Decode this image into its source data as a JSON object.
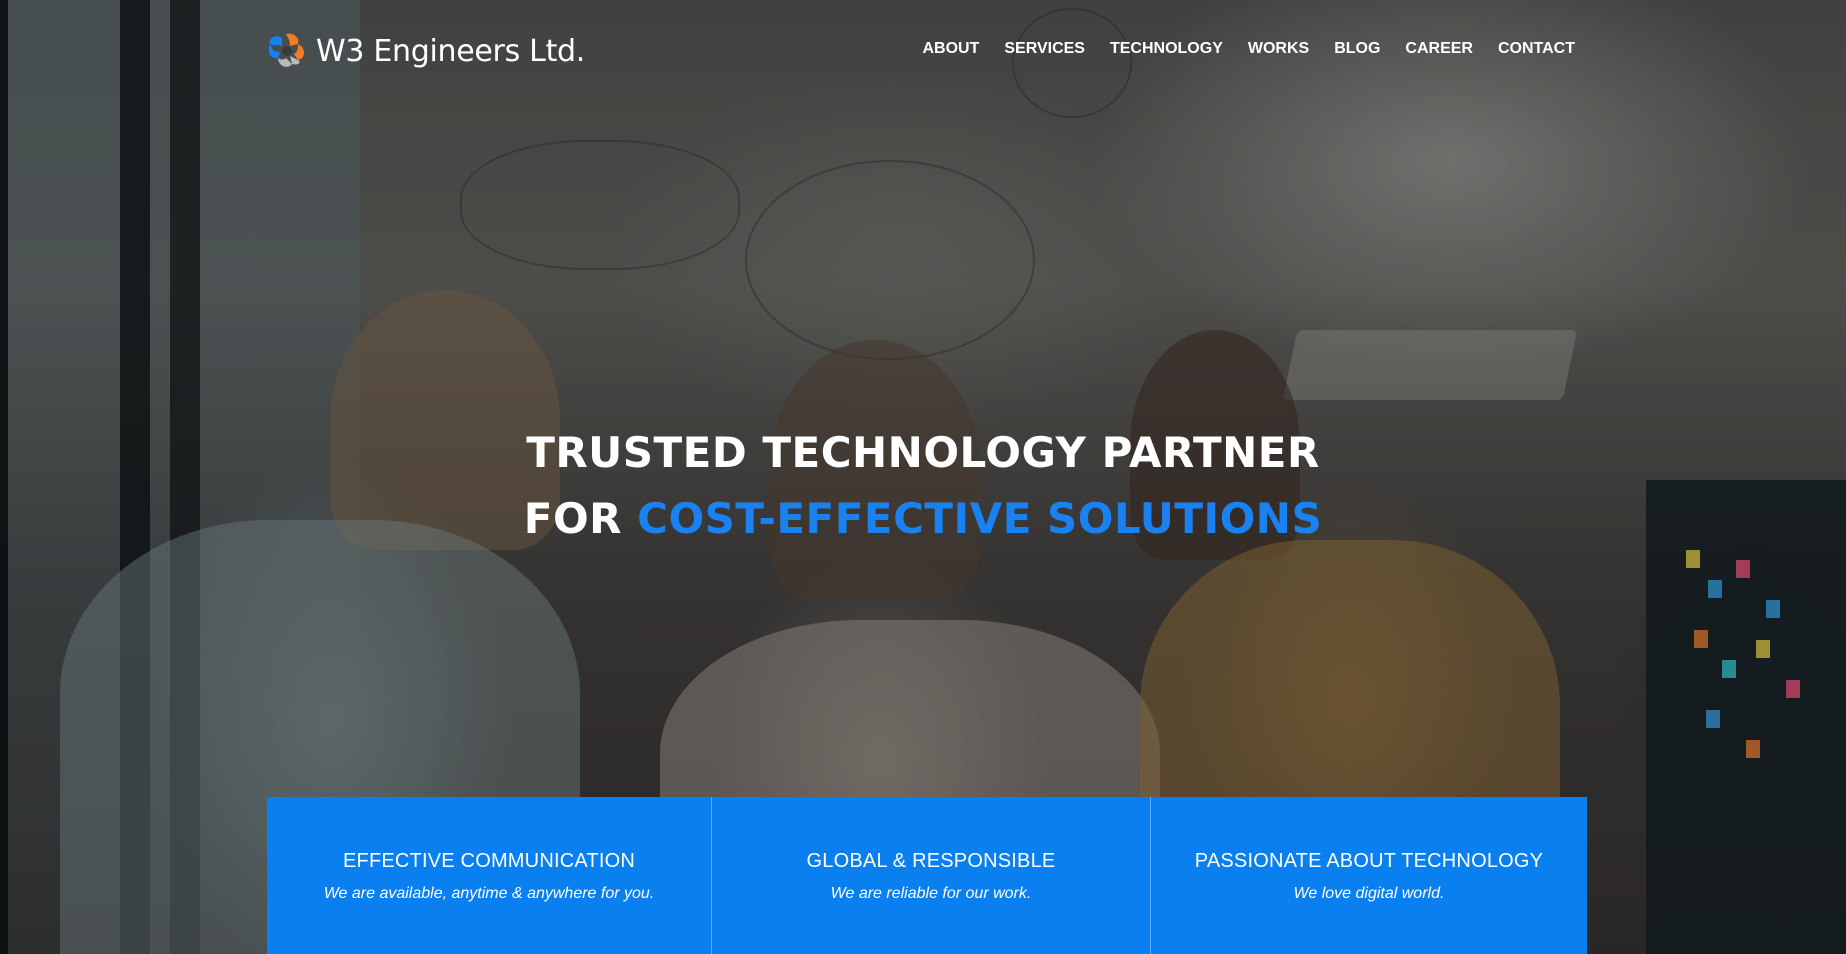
{
  "brand": {
    "name": "W3 Engineers Ltd.",
    "colors": {
      "orange": "#f47b20",
      "blue": "#1a82f0",
      "grey": "#b9b9b9"
    }
  },
  "nav": {
    "items": [
      "ABOUT",
      "SERVICES",
      "TECHNOLOGY",
      "WORKS",
      "BLOG",
      "CAREER",
      "CONTACT"
    ]
  },
  "hero": {
    "line1": "TRUSTED TECHNOLOGY PARTNER",
    "line2_prefix": "FOR ",
    "line2_accent": "COST-EFFECTIVE SOLUTIONS",
    "accent_color": "#1a82f0"
  },
  "features": [
    {
      "title": "EFFECTIVE COMMUNICATION",
      "subtitle": "We are available, anytime & anywhere for you."
    },
    {
      "title": "GLOBAL & RESPONSIBLE",
      "subtitle": "We are reliable for our work."
    },
    {
      "title": "PASSIONATE ABOUT TECHNOLOGY",
      "subtitle": "We love digital world."
    }
  ],
  "features_bg": "#0a7ff0"
}
